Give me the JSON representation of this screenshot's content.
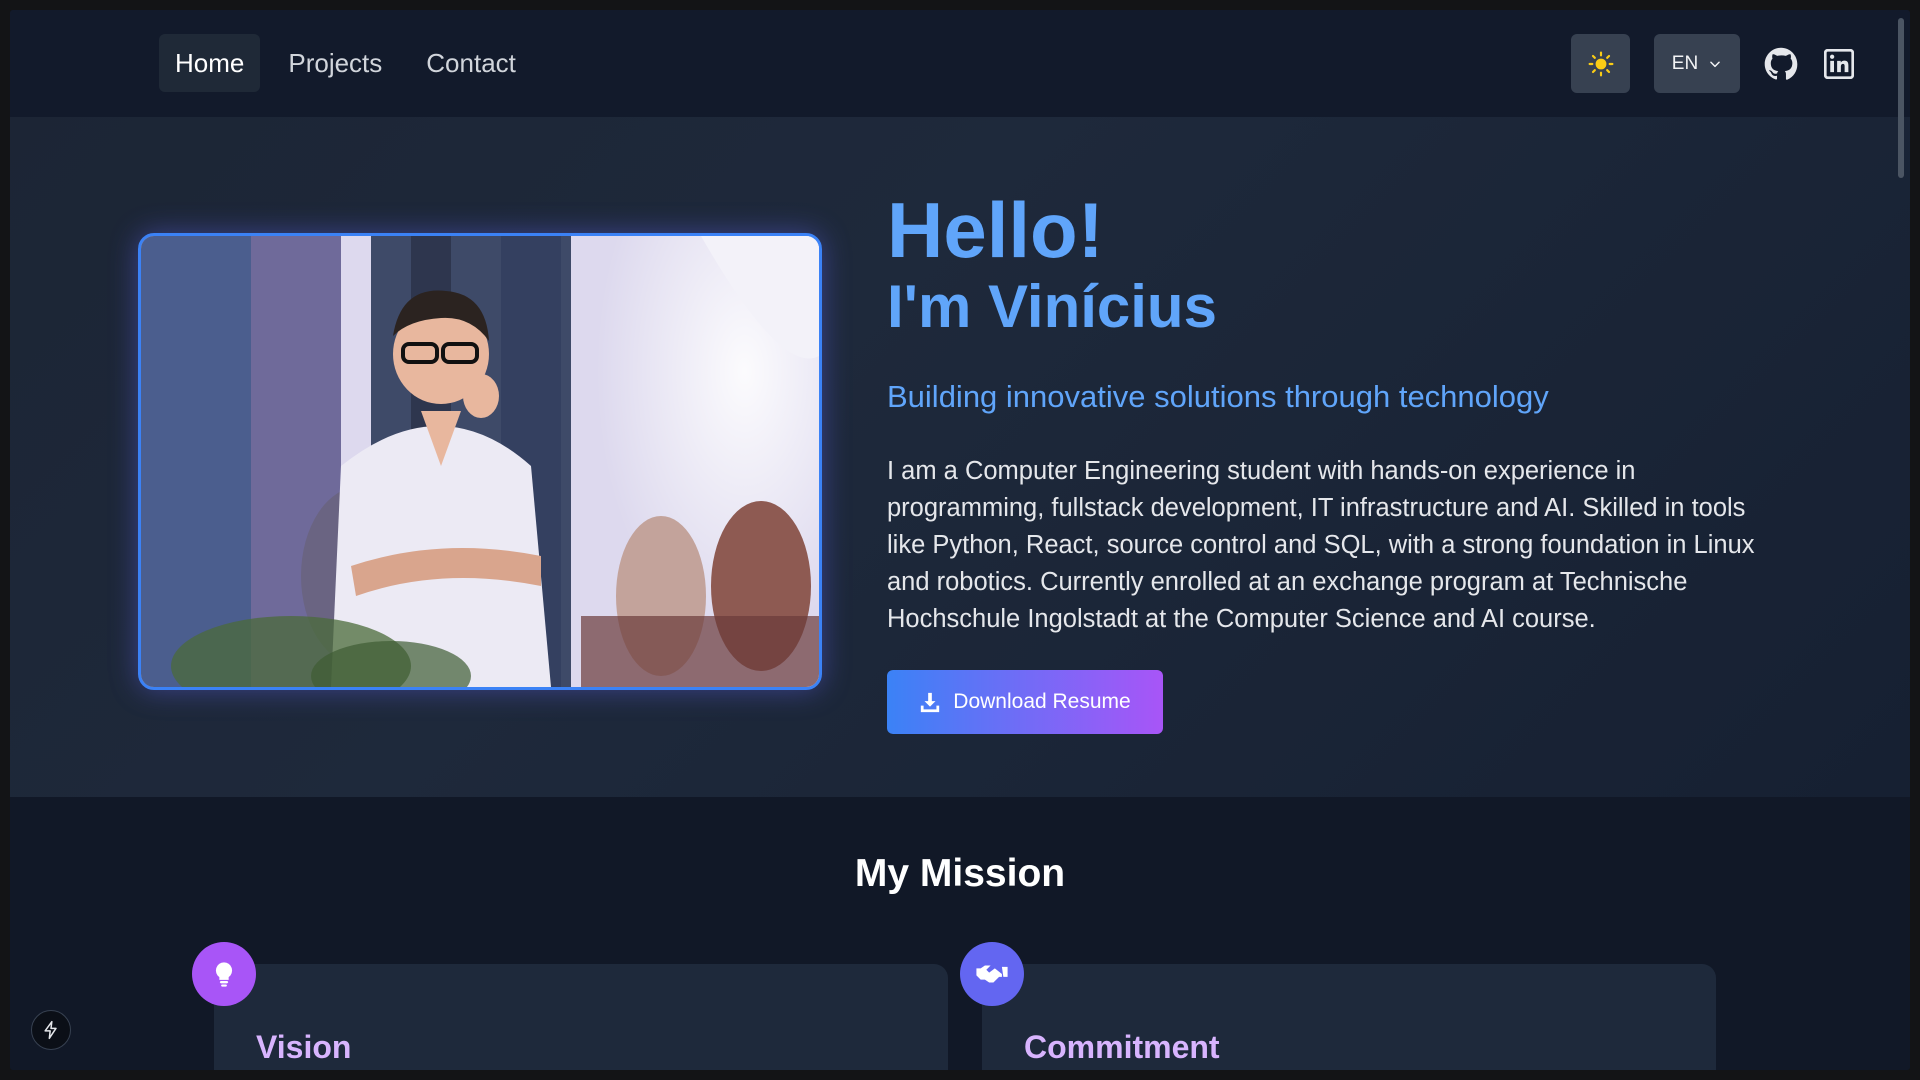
{
  "nav": {
    "links": [
      {
        "label": "Home",
        "active": true
      },
      {
        "label": "Projects",
        "active": false
      },
      {
        "label": "Contact",
        "active": false
      }
    ],
    "language": "EN",
    "icons": {
      "theme": "sun-icon",
      "language_dropdown": "chevron-down-icon",
      "github": "github-icon",
      "linkedin": "linkedin-icon"
    }
  },
  "hero": {
    "greeting": "Hello!",
    "name": "I'm Vinícius",
    "tagline": "Building innovative solutions through technology",
    "bio": "I am a Computer Engineering student with hands-on experience in programming, fullstack development, IT infrastructure and AI. Skilled in tools like Python, React, source control and SQL, with a strong foundation in Linux and robotics. Currently enrolled at an exchange program at Technische Hochschule Ingolstadt at the Computer Science and AI course.",
    "download_label": "Download Resume"
  },
  "mission": {
    "title": "My Mission",
    "cards": [
      {
        "title": "Vision",
        "icon": "lightbulb-icon",
        "color": "#a855f7"
      },
      {
        "title": "Commitment",
        "icon": "handshake-icon",
        "color": "#6366f1"
      }
    ]
  },
  "colors": {
    "accent_blue": "#60a5fa",
    "accent_purple": "#a855f7",
    "card_title": "#d8b4fe",
    "theme_icon": "#facc15"
  }
}
